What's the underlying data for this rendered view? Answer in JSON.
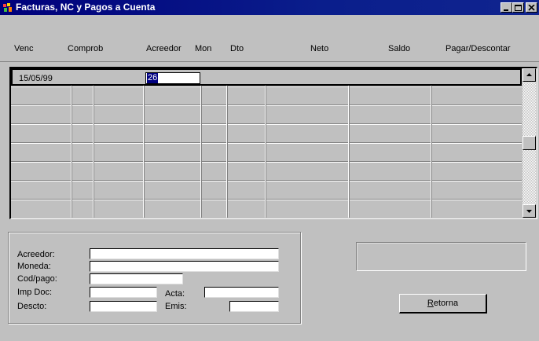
{
  "window": {
    "title": "Facturas, NC y Pagos a Cuenta",
    "controls": [
      "minimize",
      "maximize",
      "close"
    ]
  },
  "columns": [
    {
      "label": "Venc"
    },
    {
      "label": "Comprob"
    },
    {
      "label": "Acreedor"
    },
    {
      "label": "Mon"
    },
    {
      "label": "Dto"
    },
    {
      "label": "Neto"
    },
    {
      "label": "Saldo"
    },
    {
      "label": "Pagar/Descontar"
    }
  ],
  "grid": {
    "rows": [
      {
        "venc": "15/05/99",
        "comprob": "",
        "acreedor": "26",
        "mon": "",
        "dto": "",
        "neto": "",
        "saldo": "",
        "pagar": ""
      }
    ],
    "empty_rows": 7
  },
  "detail": {
    "acreedor_label": "Acreedor:",
    "moneda_label": "Moneda:",
    "cod_pago_label": "Cod/pago:",
    "imp_doc_label": "Imp Doc:",
    "descto_label": "Descto:",
    "acta_label": "Acta:",
    "emis_label": "Emis:",
    "acreedor_value": "",
    "moneda_value": "",
    "cod_pago_value": "",
    "imp_doc_value": "",
    "descto_value": "",
    "acta_value": "",
    "emis_value": ""
  },
  "actions": {
    "retorna_mnemonic": "R",
    "retorna_rest": "etorna"
  },
  "colors": {
    "title_bar": "#00007b",
    "face": "#c0c0c0",
    "selection": "#000080"
  }
}
